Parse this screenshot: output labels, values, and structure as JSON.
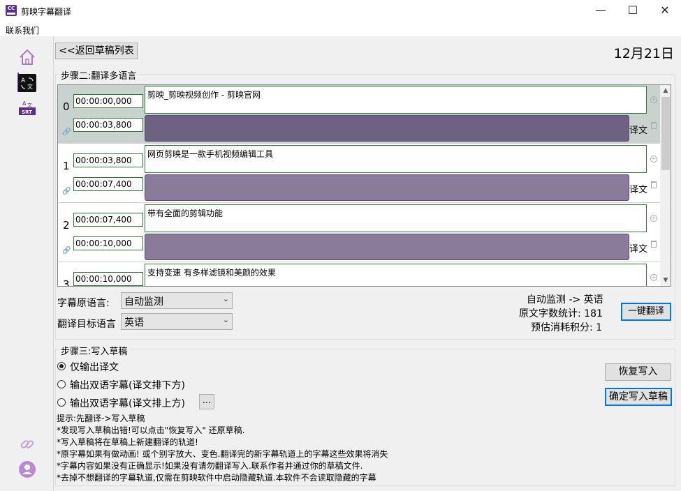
{
  "window": {
    "title": "剪映字幕翻译",
    "icon_label": "CC",
    "controls": {
      "minimize": "—",
      "maximize": "☐",
      "close": "✕"
    }
  },
  "menu": {
    "contact": "联系我们"
  },
  "header": {
    "back_button": "<<返回草稿列表",
    "date": "12月21日"
  },
  "step2": {
    "title": "步骤二:翻译多语言",
    "translation_label": "译文",
    "rows": [
      {
        "index": "0",
        "start": "00:00:00,000",
        "end": "00:00:03,800",
        "text": "剪映_剪映视频创作 - 剪映官网",
        "selected": true
      },
      {
        "index": "1",
        "start": "00:00:03,800",
        "end": "00:00:07,400",
        "text": "网页剪映是一款手机视频编辑工具",
        "selected": false
      },
      {
        "index": "2",
        "start": "00:00:07,400",
        "end": "00:00:10,000",
        "text": "带有全面的剪辑功能",
        "selected": false
      },
      {
        "index": "3",
        "start": "00:00:10,000",
        "end": "",
        "text": "支持变速 有多样滤镜和美颜的效果",
        "selected": false
      }
    ],
    "source_lang_label": "字幕原语言:",
    "source_lang_value": "自动监测",
    "target_lang_label": "翻译目标语言",
    "target_lang_value": "英语",
    "detect_info": "自动监测 -> 英语",
    "char_count": "原文字数统计: 181",
    "credits": "预估消耗积分: 1",
    "translate_button": "一键翻译"
  },
  "step3": {
    "title": "步骤三:写入草稿",
    "options": [
      {
        "label": "仅输出译文",
        "checked": true
      },
      {
        "label": "输出双语字幕(译文排下方)",
        "checked": false
      },
      {
        "label": "输出双语字幕(译文排上方)",
        "checked": false
      }
    ],
    "more_button": "...",
    "restore_button": "恢复写入",
    "confirm_button": "确定写入草稿",
    "hints": [
      "提示:先翻译->写入草稿",
      "*发现写入草稿出错!可以点击\"恢复写入\" 还原草稿.",
      "*写入草稿将在草稿上新建翻译的轨道!",
      "*原字幕如果有做动画! 或个别字放大、变色.翻译完的新字幕轨道上的字幕这些效果将消失",
      "*字幕内容如果没有正确显示!如果没有请勿翻译写入.联系作者并通过你的草稿文件.",
      "*去掉不想翻译的字幕轨道,仅需在剪映软件中启动隐藏轨道.本软件不会读取隐藏的字幕"
    ]
  },
  "colors": {
    "selected_row": "#c9d2cf",
    "trans_box_selected": "#6e6283",
    "trans_box": "#8b7b9b",
    "input_border": "#2e7d32",
    "accent_blue": "#0078d7",
    "brand_purple": "#5a2d91"
  },
  "icons": {
    "sidebar": [
      "home-icon",
      "translate-icon",
      "srt-icon",
      "link-icon",
      "user-icon"
    ]
  }
}
